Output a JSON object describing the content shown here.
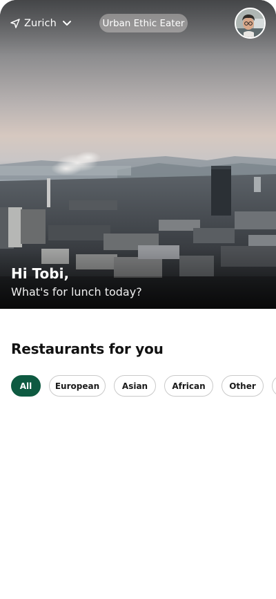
{
  "header": {
    "location": "Zurich",
    "app_title": "Urban Ethic Eater",
    "location_icon": "navigation-arrow-icon",
    "dropdown_icon": "chevron-down-icon",
    "avatar": "user-avatar"
  },
  "hero": {
    "greeting": "Hi Tobi,",
    "subtitle": "What's for lunch today?"
  },
  "restaurants": {
    "title": "Restaurants for you",
    "filters": [
      {
        "label": "All",
        "active": true
      },
      {
        "label": "European",
        "active": false
      },
      {
        "label": "Asian",
        "active": false
      },
      {
        "label": "African",
        "active": false
      },
      {
        "label": "Other",
        "active": false
      },
      {
        "label": "",
        "active": false
      }
    ]
  },
  "colors": {
    "accent": "#0e5a41",
    "chip_border": "#c9c9c9",
    "text": "#111111"
  }
}
